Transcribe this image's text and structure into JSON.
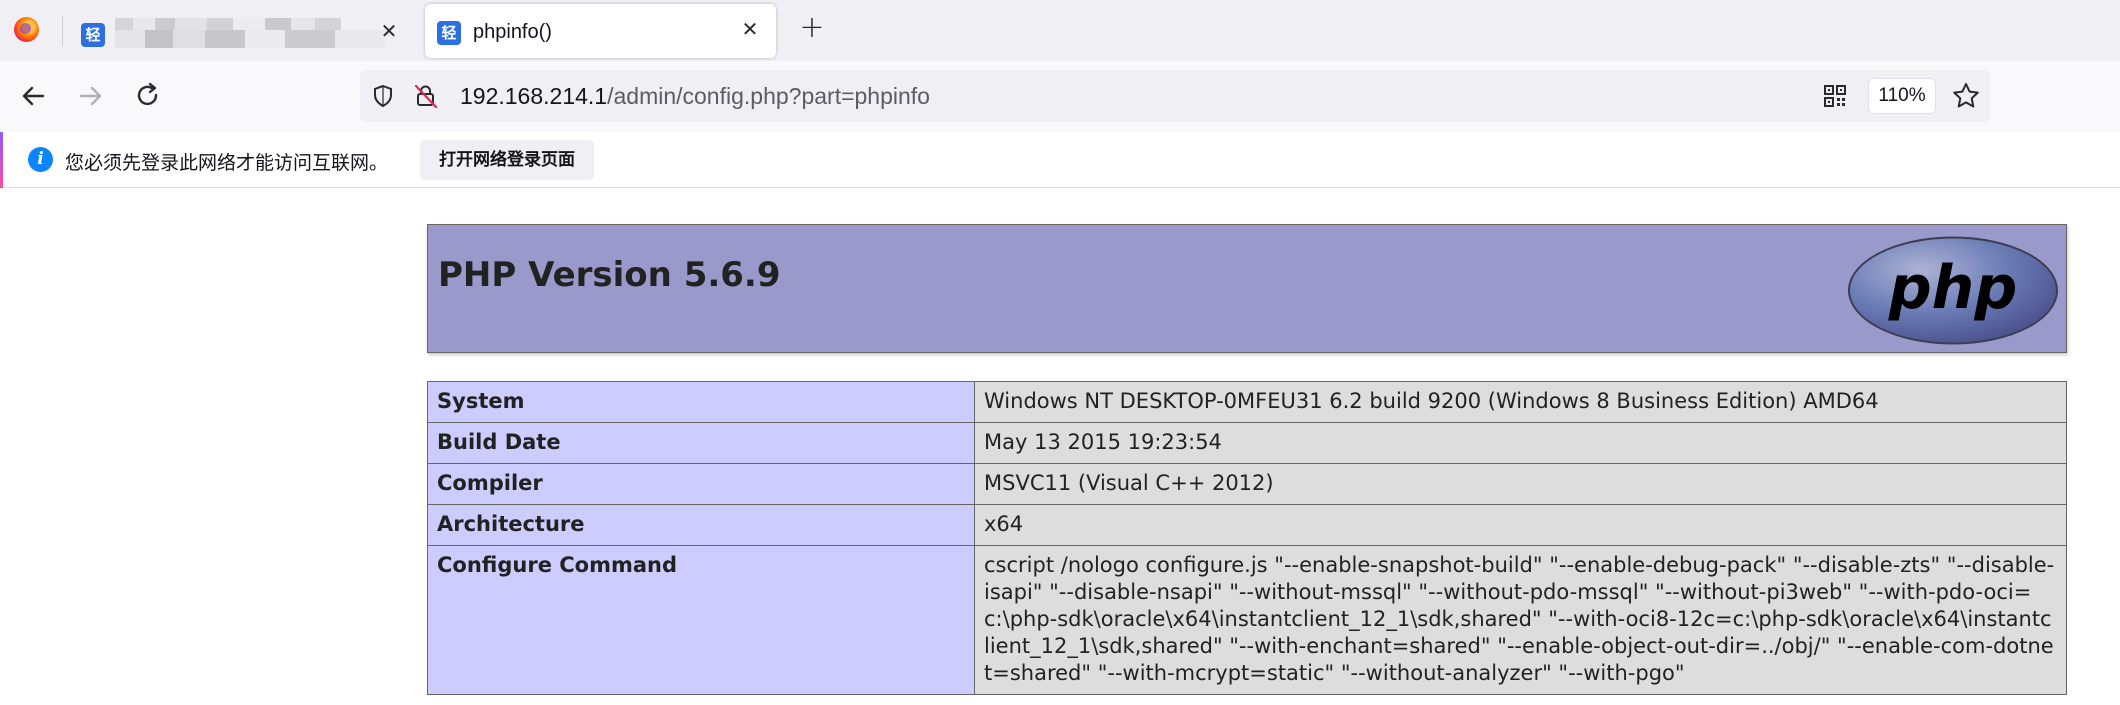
{
  "browser": {
    "tabs": [
      {
        "title": "",
        "favicon": "轻",
        "active": false,
        "blurred": true
      },
      {
        "title": "phpinfo()",
        "favicon": "轻",
        "active": true
      }
    ],
    "new_tab_label": "+",
    "address_bar": {
      "host": "192.168.214.1",
      "path": "/admin/config.php?part=phpinfo"
    },
    "zoom": "110%",
    "notification": {
      "message": "您必须先登录此网络才能访问互联网。",
      "button": "打开网络登录页面"
    }
  },
  "phpinfo": {
    "title": "PHP Version 5.6.9",
    "logo_text": "php",
    "rows": [
      {
        "key": "System",
        "value": "Windows NT DESKTOP-0MFEU31 6.2 build 9200 (Windows 8 Business Edition) AMD64"
      },
      {
        "key": "Build Date",
        "value": "May 13 2015 19:23:54"
      },
      {
        "key": "Compiler",
        "value": "MSVC11 (Visual C++ 2012)"
      },
      {
        "key": "Architecture",
        "value": "x64"
      },
      {
        "key": "Configure Command",
        "value": "cscript /nologo configure.js \"--enable-snapshot-build\" \"--enable-debug-pack\" \"--disable-zts\" \"--disable-isapi\" \"--disable-nsapi\" \"--without-mssql\" \"--without-pdo-mssql\" \"--without-pi3web\" \"--with-pdo-oci=c:\\php-sdk\\oracle\\x64\\instantclient_12_1\\sdk,shared\" \"--with-oci8-12c=c:\\php-sdk\\oracle\\x64\\instantclient_12_1\\sdk,shared\" \"--with-enchant=shared\" \"--enable-object-out-dir=../obj/\" \"--enable-com-dotnet=shared\" \"--with-mcrypt=static\" \"--without-analyzer\" \"--with-pgo\""
      }
    ]
  },
  "colors": {
    "header_bg": "#9999cc",
    "key_bg": "#ccccff",
    "value_bg": "#dddddd"
  }
}
